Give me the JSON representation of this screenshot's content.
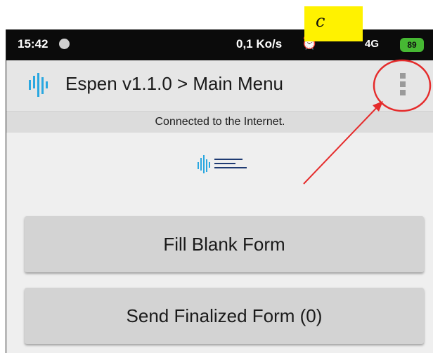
{
  "status_bar": {
    "time": "15:42",
    "network_speed": "0,1 Ko/s",
    "network_type": "4G",
    "battery_level": "89"
  },
  "app_bar": {
    "title": "Espen v1.1.0 > Main Menu",
    "menu_icon": "more-vert-icon"
  },
  "connection": {
    "message": "Connected to the Internet."
  },
  "buttons": {
    "fill_blank_form": "Fill Blank Form",
    "send_finalized_form": "Send Finalized Form (0)"
  },
  "annotation": {
    "label": "c",
    "highlight_color": "#fff200",
    "marker_color": "#e52b2b"
  },
  "colors": {
    "logo_blue": "#2aa7e0",
    "logo_navy": "#1f3b73"
  }
}
